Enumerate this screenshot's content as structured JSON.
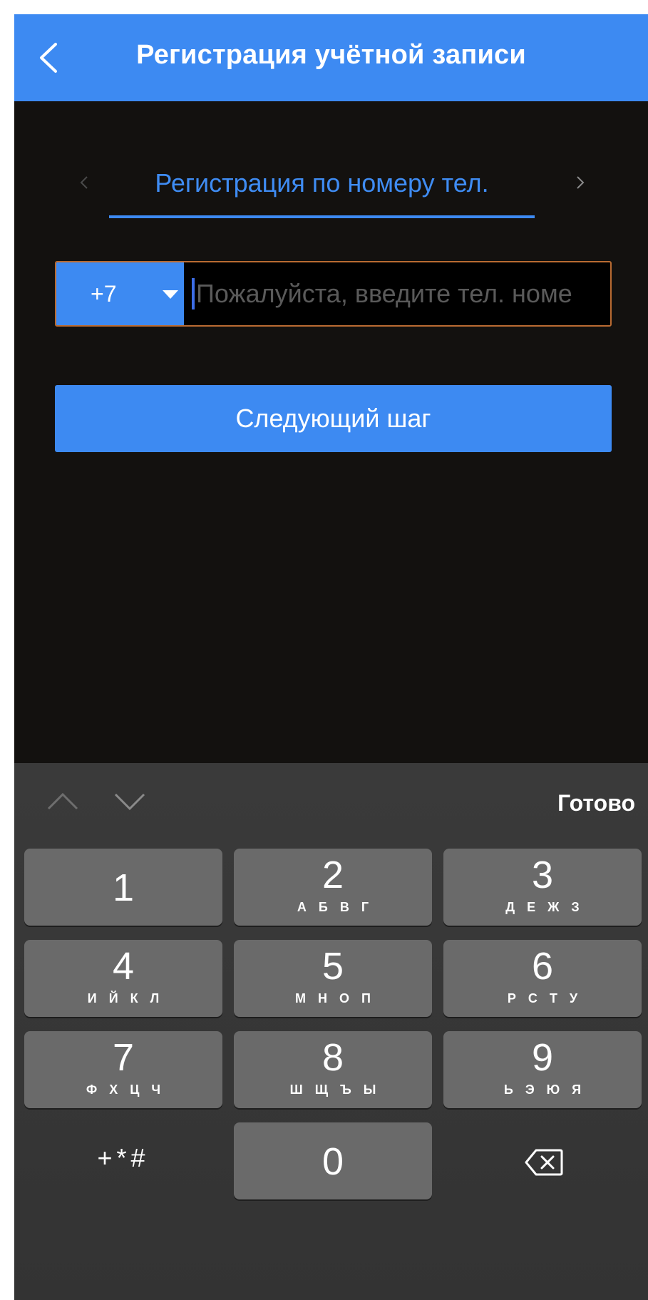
{
  "header": {
    "title": "Регистрация учётной записи",
    "back_icon": "chevron-left-icon"
  },
  "tabs": {
    "active_label": "Регистрация по номеру тел.",
    "prev_icon": "chevron-left-icon",
    "next_icon": "chevron-right-icon"
  },
  "phone_form": {
    "country_code": "+7",
    "country_dropdown_icon": "caret-down-icon",
    "phone_placeholder": "Пожалуйста, введите тел. номе",
    "phone_value": ""
  },
  "next_button": {
    "label": "Следующий шаг"
  },
  "keyboard": {
    "done_label": "Готово",
    "up_icon": "chevron-up-icon",
    "down_icon": "chevron-down-icon",
    "keys": [
      {
        "digit": "1",
        "letters": ""
      },
      {
        "digit": "2",
        "letters": "А Б В Г"
      },
      {
        "digit": "3",
        "letters": "Д Е Ж З"
      },
      {
        "digit": "4",
        "letters": "И Й К Л"
      },
      {
        "digit": "5",
        "letters": "М Н О П"
      },
      {
        "digit": "6",
        "letters": "Р С Т У"
      },
      {
        "digit": "7",
        "letters": "Ф Х Ц Ч"
      },
      {
        "digit": "8",
        "letters": "Ш Щ Ъ Ы"
      },
      {
        "digit": "9",
        "letters": "Ь Э Ю Я"
      },
      {
        "digit": "0",
        "letters": ""
      }
    ],
    "symbols_label": "+*#",
    "delete_icon": "backspace-icon"
  },
  "colors": {
    "accent": "#3d8af2",
    "background": "#13110f",
    "field_border": "#b96b32",
    "keyboard_bg": "#363636",
    "key_bg": "#6a6a6a"
  }
}
